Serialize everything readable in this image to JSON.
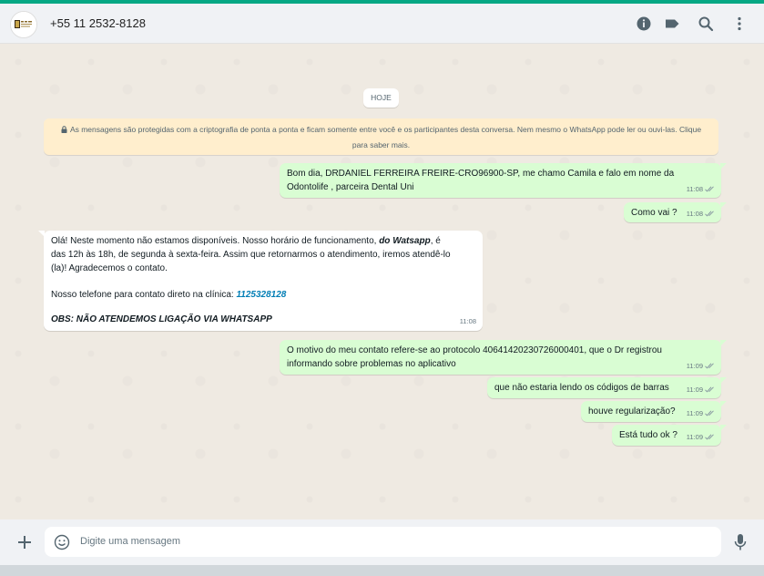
{
  "colors": {
    "accent": "#06a884",
    "outgoing": "#d9fdd3",
    "incoming": "#ffffff",
    "link": "#027eb5",
    "notice": "#ffeecd"
  },
  "header": {
    "contact_name": "+55 11 2532-8128",
    "icons": [
      "info-icon",
      "label-icon",
      "search-icon",
      "menu-icon"
    ]
  },
  "chat": {
    "date_chip": "HOJE",
    "encryption_notice": "As mensagens são protegidas com a criptografia de ponta a ponta e ficam somente entre você e os participantes desta conversa. Nem mesmo o WhatsApp pode ler ou ouvi-las. Clique para saber mais.",
    "messages": [
      {
        "dir": "out",
        "lines": [
          "Bom dia, DRDANIEL FERREIRA FREIRE-CRO96900-SP, me chamo Camila e falo em nome da",
          "Odontolife , parceira Dental Uni"
        ],
        "time": "11:08"
      },
      {
        "dir": "out",
        "lines": [
          "Como vai ?"
        ],
        "time": "11:08"
      },
      {
        "dir": "in",
        "line1_pre": "Olá! Neste momento não estamos disponíveis. Nosso horário de funcionamento, ",
        "line1_bold": "do Watsapp",
        "line1_post": ", é",
        "line2": "das 12h às 18h, de segunda à sexta-feira. Assim que retornarmos o atendimento, iremos atendê-lo",
        "line3": "(la)! Agradecemos o contato.",
        "phone_label": "Nosso telefone para contato direto na clínica: ",
        "phone": "1125328128",
        "obs": "OBS: NÃO ATENDEMOS LIGAÇÃO VIA WHATSAPP",
        "time": "11:08"
      },
      {
        "dir": "out",
        "lines": [
          "O motivo do meu contato refere-se ao protocolo 40641420230726000401, que o Dr registrou",
          "informando sobre problemas no aplicativo"
        ],
        "time": "11:09"
      },
      {
        "dir": "out",
        "lines": [
          "que não estaria lendo os códigos de barras"
        ],
        "time": "11:09"
      },
      {
        "dir": "out",
        "lines": [
          "houve regularização?"
        ],
        "time": "11:09"
      },
      {
        "dir": "out",
        "lines": [
          "Está tudo ok ?"
        ],
        "time": "11:09"
      }
    ]
  },
  "composer": {
    "placeholder": "Digite uma mensagem",
    "icons": [
      "plus-icon",
      "emoji-icon",
      "microphone-icon"
    ]
  }
}
